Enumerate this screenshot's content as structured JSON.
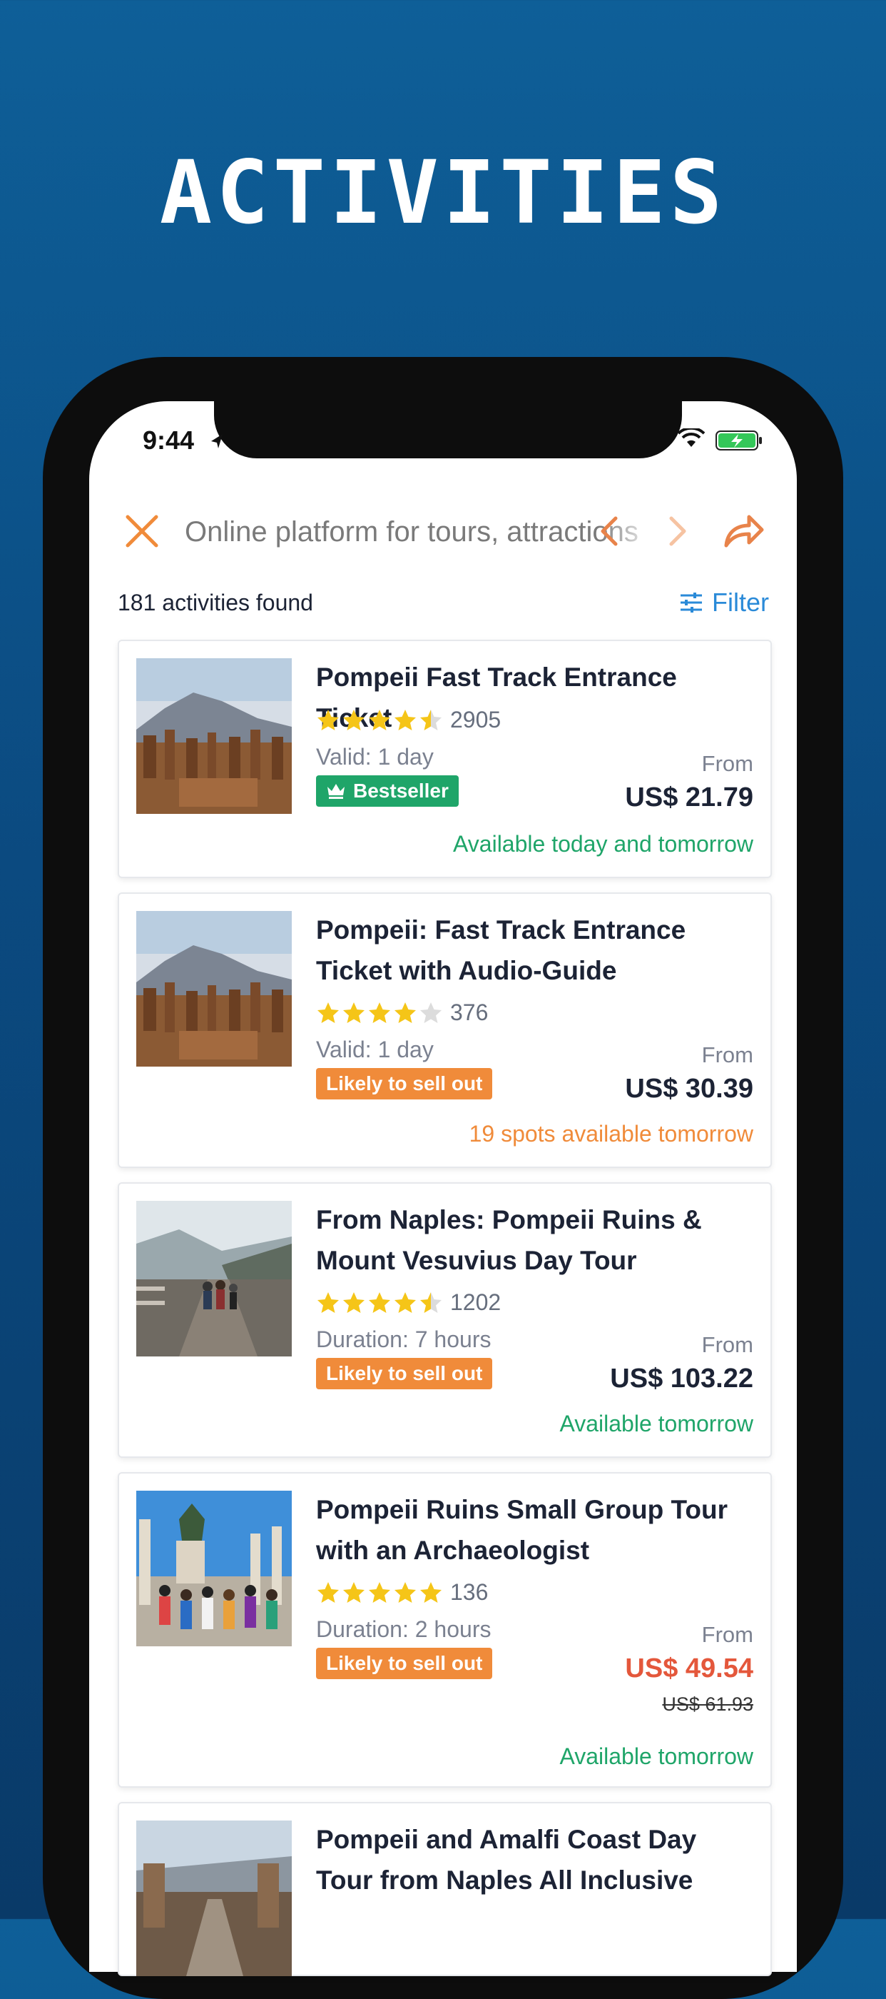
{
  "headline": "ACTIVITIES",
  "status_bar": {
    "time": "9:44"
  },
  "toolbar": {
    "url_text": "Online platform for tours, attractions"
  },
  "results": {
    "count_text": "181 activities found",
    "filter_label": "Filter"
  },
  "colors": {
    "accent_orange": "#f08b3a",
    "accent_blue": "#2a8ad8",
    "green": "#1fa569",
    "star": "#f5c518",
    "sale_red": "#e4573b"
  },
  "cards": [
    {
      "title": "Pompeii Fast Track Entrance Ticket",
      "rating": 4.5,
      "reviews": "2905",
      "meta": "Valid: 1 day",
      "badge": "Bestseller",
      "from_label": "From",
      "price": "US$ 21.79",
      "availability": "Available today and tomorrow"
    },
    {
      "title": "Pompeii: Fast Track Entrance Ticket with Audio-Guide",
      "rating": 4,
      "reviews": "376",
      "meta": "Valid: 1 day",
      "badge": "Likely to sell out",
      "from_label": "From",
      "price": "US$ 30.39",
      "availability": "19 spots available tomorrow"
    },
    {
      "title": "From Naples: Pompeii Ruins & Mount Vesuvius Day Tour",
      "rating": 4.5,
      "reviews": "1202",
      "meta": "Duration: 7 hours",
      "badge": "Likely to sell out",
      "from_label": "From",
      "price": "US$ 103.22",
      "availability": "Available tomorrow"
    },
    {
      "title": "Pompeii Ruins Small Group Tour with an Archaeologist",
      "rating": 5,
      "reviews": "136",
      "meta": "Duration: 2 hours",
      "badge": "Likely to sell out",
      "from_label": "From",
      "price": "US$ 49.54",
      "old_price": "US$ 61.93",
      "availability": "Available tomorrow"
    },
    {
      "title": "Pompeii and Amalfi Coast Day Tour from Naples All Inclusive"
    }
  ]
}
